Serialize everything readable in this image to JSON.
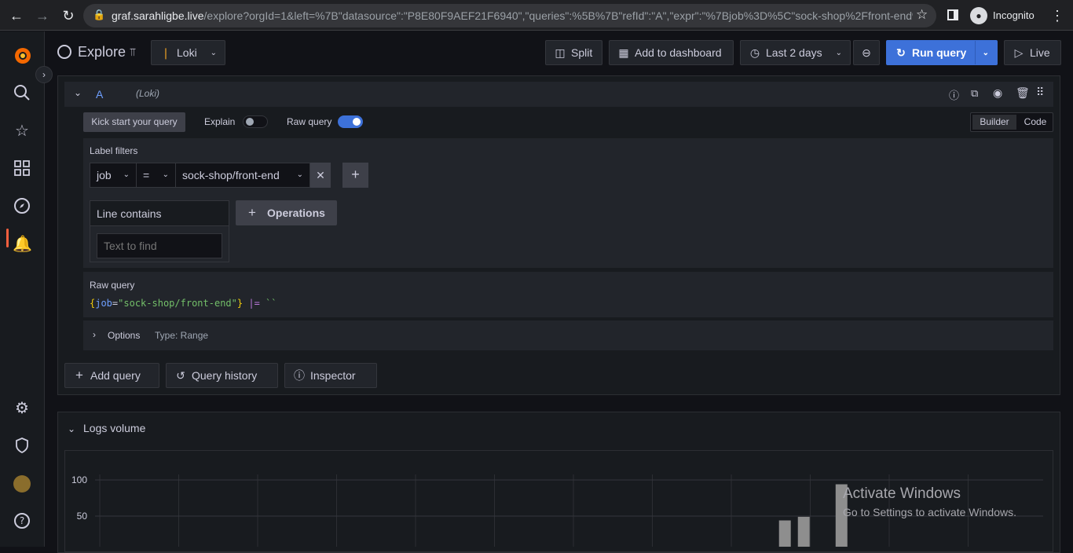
{
  "browser": {
    "url_host": "graf.sarahligbe.live",
    "url_rest": "/explore?orgId=1&left=%7B\"datasource\":\"P8E80F9AEF21F6940\",\"queries\":%5B%7B\"refId\":\"A\",\"expr\":\"%7Bjob%3D%5C\"sock-shop%2Ffront-end%5...",
    "incognito_label": "Incognito"
  },
  "topbar": {
    "title": "Explore",
    "datasource": "Loki",
    "split_label": "Split",
    "add_dashboard_label": "Add to dashboard",
    "time_range": "Last 2 days",
    "run_query_label": "Run query",
    "live_label": "Live"
  },
  "query": {
    "ref_id": "A",
    "datasource_tag": "(Loki)",
    "kick_start_label": "Kick start your query",
    "explain_label": "Explain",
    "raw_query_toggle_label": "Raw query",
    "builder_label": "Builder",
    "code_label": "Code",
    "label_filters_title": "Label filters",
    "filter_label": "job",
    "filter_op": "=",
    "filter_value": "sock-shop/front-end",
    "line_contains_title": "Line contains",
    "text_placeholder": "Text to find",
    "operations_label": "Operations",
    "raw_query_title": "Raw query",
    "raw_open": "{",
    "raw_key": "job",
    "raw_eq": "=",
    "raw_val": "\"sock-shop/front-end\"",
    "raw_close": "}",
    "raw_pipe": "|=",
    "raw_empty": "``",
    "options_label": "Options",
    "options_type": "Type: Range"
  },
  "actions": {
    "add_query": "Add query",
    "query_history": "Query history",
    "inspector": "Inspector"
  },
  "logs_volume": {
    "title": "Logs volume"
  },
  "chart_data": {
    "type": "bar",
    "title": "Logs volume",
    "y_ticks": [
      "100",
      "50"
    ],
    "ylim": [
      0,
      110
    ],
    "bars": [
      {
        "slot": 0.72,
        "value": 44
      },
      {
        "slot": 0.74,
        "value": 49
      },
      {
        "slot": 0.78,
        "value": 94
      },
      {
        "slot": 0.93,
        "value": 4
      }
    ]
  },
  "watermark": {
    "line1": "Activate Windows",
    "line2": "Go to Settings to activate Windows."
  }
}
